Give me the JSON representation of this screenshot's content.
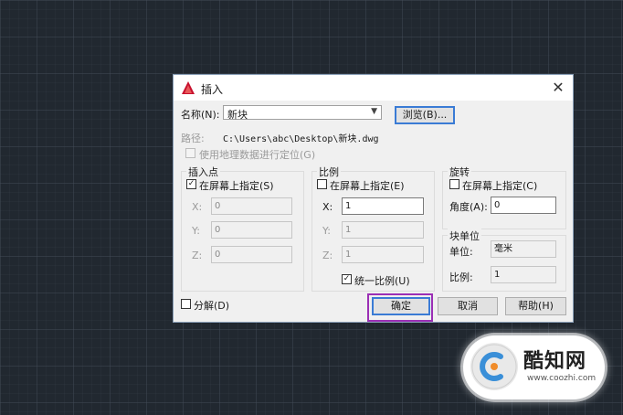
{
  "dialog": {
    "title": "插入",
    "name_label": "名称(N):",
    "name_value": "新块",
    "browse_label": "浏览(B)...",
    "path_label": "路径:",
    "path_value": "C:\\Users\\abc\\Desktop\\新块.dwg",
    "geo_label": "使用地理数据进行定位(G)",
    "insertion": {
      "title": "插入点",
      "specify_label": "在屏幕上指定(S)",
      "x_label": "X:",
      "x_value": "0",
      "y_label": "Y:",
      "y_value": "0",
      "z_label": "Z:",
      "z_value": "0"
    },
    "scale": {
      "title": "比例",
      "specify_label": "在屏幕上指定(E)",
      "x_label": "X:",
      "x_value": "1",
      "y_label": "Y:",
      "y_value": "1",
      "z_label": "Z:",
      "z_value": "1",
      "uniform_label": "统一比例(U)"
    },
    "rotation": {
      "title": "旋转",
      "specify_label": "在屏幕上指定(C)",
      "angle_label": "角度(A):",
      "angle_value": "0"
    },
    "block_unit": {
      "title": "块单位",
      "unit_label": "单位:",
      "unit_value": "毫米",
      "factor_label": "比例:",
      "factor_value": "1"
    },
    "explode_label": "分解(D)",
    "ok_label": "确定",
    "cancel_label": "取消",
    "help_label": "帮助(H)"
  },
  "watermark": {
    "title": "酷知网",
    "url": "www.coozhi.com"
  }
}
